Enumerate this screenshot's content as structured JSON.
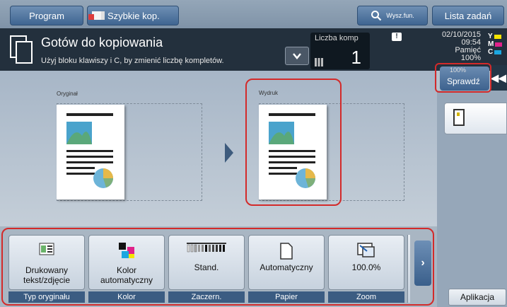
{
  "topbar": {
    "program_label": "Program",
    "szybkie_label": "Szybkie kop.",
    "search_label": "Wysz.fun.",
    "jobs_label": "Lista zadań"
  },
  "status": {
    "title": "Gotów do kopiowania",
    "hint": "Użyj bloku klawiszy i C, by zmienić liczbę kompletów.",
    "copies_label": "Liczba komp",
    "copies_value": "1",
    "date": "02/10/2015",
    "time": "09:54",
    "memory_label": "Pamięć",
    "memory_value": "100%",
    "warn_symbol": "!",
    "toner": [
      {
        "letter": "Y",
        "color": "#f5e400"
      },
      {
        "letter": "M",
        "color": "#e0218a"
      },
      {
        "letter": "C",
        "color": "#1ca7e0"
      }
    ]
  },
  "preview": {
    "original_label": "Oryginał",
    "output_label": "Wydruk",
    "check_label": "Sprawdź"
  },
  "functions": [
    {
      "value_lines": [
        "Drukowany",
        "tekst/zdjęcie"
      ],
      "caption": "Typ oryginału",
      "icon": "text-photo-icon"
    },
    {
      "value_lines": [
        "Kolor",
        "automatyczny"
      ],
      "caption": "Kolor",
      "icon": "color-mode-icon"
    },
    {
      "value_lines": [
        "Stand."
      ],
      "caption": "Zaczern.",
      "icon": "density-icon"
    },
    {
      "value_lines": [
        "Automatyczny"
      ],
      "caption": "Papier",
      "icon": "paper-icon"
    },
    {
      "value_lines": [
        "100.0%"
      ],
      "caption": "Zoom",
      "icon": "zoom-icon"
    }
  ],
  "aplikacja_label": "Aplikacja"
}
